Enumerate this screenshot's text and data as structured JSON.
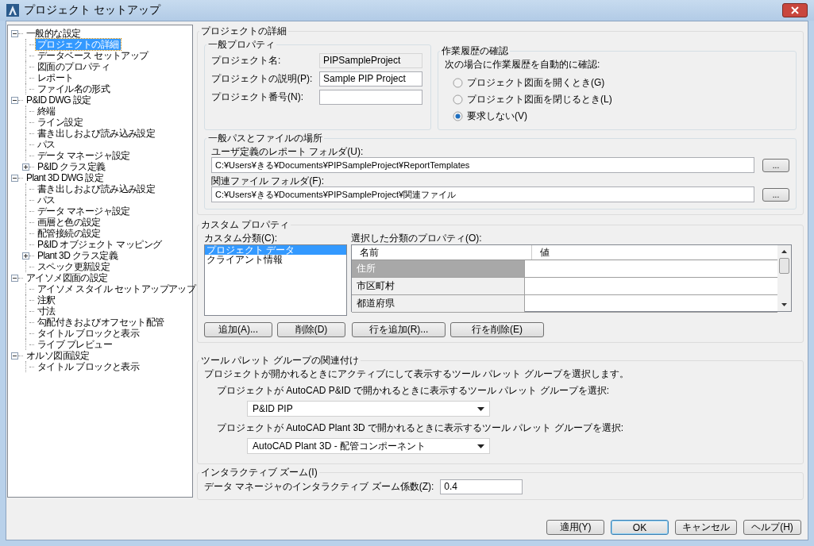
{
  "window": {
    "title": "プロジェクト セットアップ"
  },
  "tree": [
    {
      "label": "一般的な設定",
      "selected": false,
      "expanded": true,
      "children": [
        {
          "label": "プロジェクトの詳細",
          "selected": true
        },
        {
          "label": "データベース セットアップ",
          "selected": false
        },
        {
          "label": "図面のプロパティ",
          "selected": false
        },
        {
          "label": "レポート",
          "selected": false
        },
        {
          "label": "ファイル名の形式",
          "selected": false
        }
      ]
    },
    {
      "label": "P&ID DWG 設定",
      "selected": false,
      "expanded": true,
      "children": [
        {
          "label": "終端",
          "selected": false
        },
        {
          "label": "ライン設定",
          "selected": false
        },
        {
          "label": "書き出しおよび読み込み設定",
          "selected": false
        },
        {
          "label": "パス",
          "selected": false
        },
        {
          "label": "データ マネージャ設定",
          "selected": false
        },
        {
          "label": "P&ID クラス定義",
          "selected": false,
          "expanded": false
        }
      ]
    },
    {
      "label": "Plant 3D DWG 設定",
      "selected": false,
      "expanded": true,
      "children": [
        {
          "label": "書き出しおよび読み込み設定",
          "selected": false
        },
        {
          "label": "パス",
          "selected": false
        },
        {
          "label": "データ マネージャ設定",
          "selected": false
        },
        {
          "label": "画層と色の設定",
          "selected": false
        },
        {
          "label": "配管接続の設定",
          "selected": false
        },
        {
          "label": "P&ID オブジェクト マッピング",
          "selected": false
        },
        {
          "label": "Plant 3D クラス定義",
          "selected": false,
          "expanded": false
        },
        {
          "label": "スペック更新設定",
          "selected": false
        }
      ]
    },
    {
      "label": "アイソメ図面の設定",
      "selected": false,
      "expanded": true,
      "children": [
        {
          "label": "アイソメ スタイル セットアップアップ",
          "selected": false
        },
        {
          "label": "注釈",
          "selected": false
        },
        {
          "label": "寸法",
          "selected": false
        },
        {
          "label": "勾配付きおよびオフセット配管",
          "selected": false
        },
        {
          "label": "タイトル ブロックと表示",
          "selected": false
        },
        {
          "label": "ライブ プレビュー",
          "selected": false
        }
      ]
    },
    {
      "label": "オルソ図面設定",
      "selected": false,
      "expanded": true,
      "children": [
        {
          "label": "タイトル ブロックと表示",
          "selected": false
        }
      ]
    }
  ],
  "details": {
    "title": "プロジェクトの詳細",
    "general": {
      "title": "一般プロパティ",
      "fields": [
        {
          "label": "プロジェクト名:",
          "value": "PIPSampleProject",
          "disabled": true
        },
        {
          "label": "プロジェクトの説明(P):",
          "value": "Sample PIP Project",
          "disabled": false
        },
        {
          "label": "プロジェクト番号(N):",
          "disabled": false
        }
      ]
    },
    "history": {
      "title": "作業履歴の確認",
      "prompt": "次の場合に作業履歴を自動的に確認:",
      "options": [
        {
          "label": "プロジェクト図面を開くとき(G)",
          "selected": false
        },
        {
          "label": "プロジェクト図面を閉じるとき(L)",
          "selected": false
        },
        {
          "label": "要求しない(V)",
          "selected": true
        }
      ]
    },
    "paths": {
      "title": "一般パスとファイルの場所",
      "fields": [
        {
          "label": "ユーザ定義のレポート フォルダ(U):",
          "value": "C:¥Users¥きる¥Documents¥PIPSampleProject¥ReportTemplates",
          "button": "..."
        },
        {
          "label": "関連ファイル フォルダ(F):",
          "value": "C:¥Users¥きる¥Documents¥PIPSampleProject¥関連ファイル",
          "button": "..."
        }
      ]
    }
  },
  "custom": {
    "title": "カスタム プロパティ",
    "categories_label": "カスタム分類(C):",
    "categories": [
      {
        "label": "プロジェクト データ",
        "selected": true
      },
      {
        "label": "クライアント情報",
        "selected": false
      }
    ],
    "properties_label": "選択した分類のプロパティ(O):",
    "columns": [
      "名前",
      "値"
    ],
    "rows": [
      {
        "name": "住所",
        "selected": true
      },
      {
        "name": "市区町村",
        "selected": false
      },
      {
        "name": "都道府県",
        "selected": false
      }
    ],
    "buttons": [
      "追加(A)...",
      "削除(D)",
      "行を追加(R)...",
      "行を削除(E)"
    ]
  },
  "palette": {
    "title": "ツール パレット グループの関連付け",
    "intro": "プロジェクトが開かれるときにアクティブにして表示するツール パレット グループを選択します。",
    "groups": [
      {
        "label": "プロジェクトが AutoCAD P&ID で開かれるときに表示するツール パレット グループを選択:",
        "value": "P&ID PIP"
      },
      {
        "label": "プロジェクトが AutoCAD Plant 3D で開かれるときに表示するツール パレット グループを選択:",
        "value": "AutoCAD Plant 3D - 配管コンポーネント"
      }
    ]
  },
  "zoom": {
    "title": "インタラクティブ ズーム(I)",
    "label": "データ マネージャのインタラクティブ ズーム係数(Z):",
    "value": "0.4"
  },
  "buttons": [
    {
      "label": "適用(Y)",
      "default": false
    },
    {
      "label": "OK",
      "default": true
    },
    {
      "label": "キャンセル",
      "default": false
    },
    {
      "label": "ヘルプ(H)",
      "default": false
    }
  ]
}
